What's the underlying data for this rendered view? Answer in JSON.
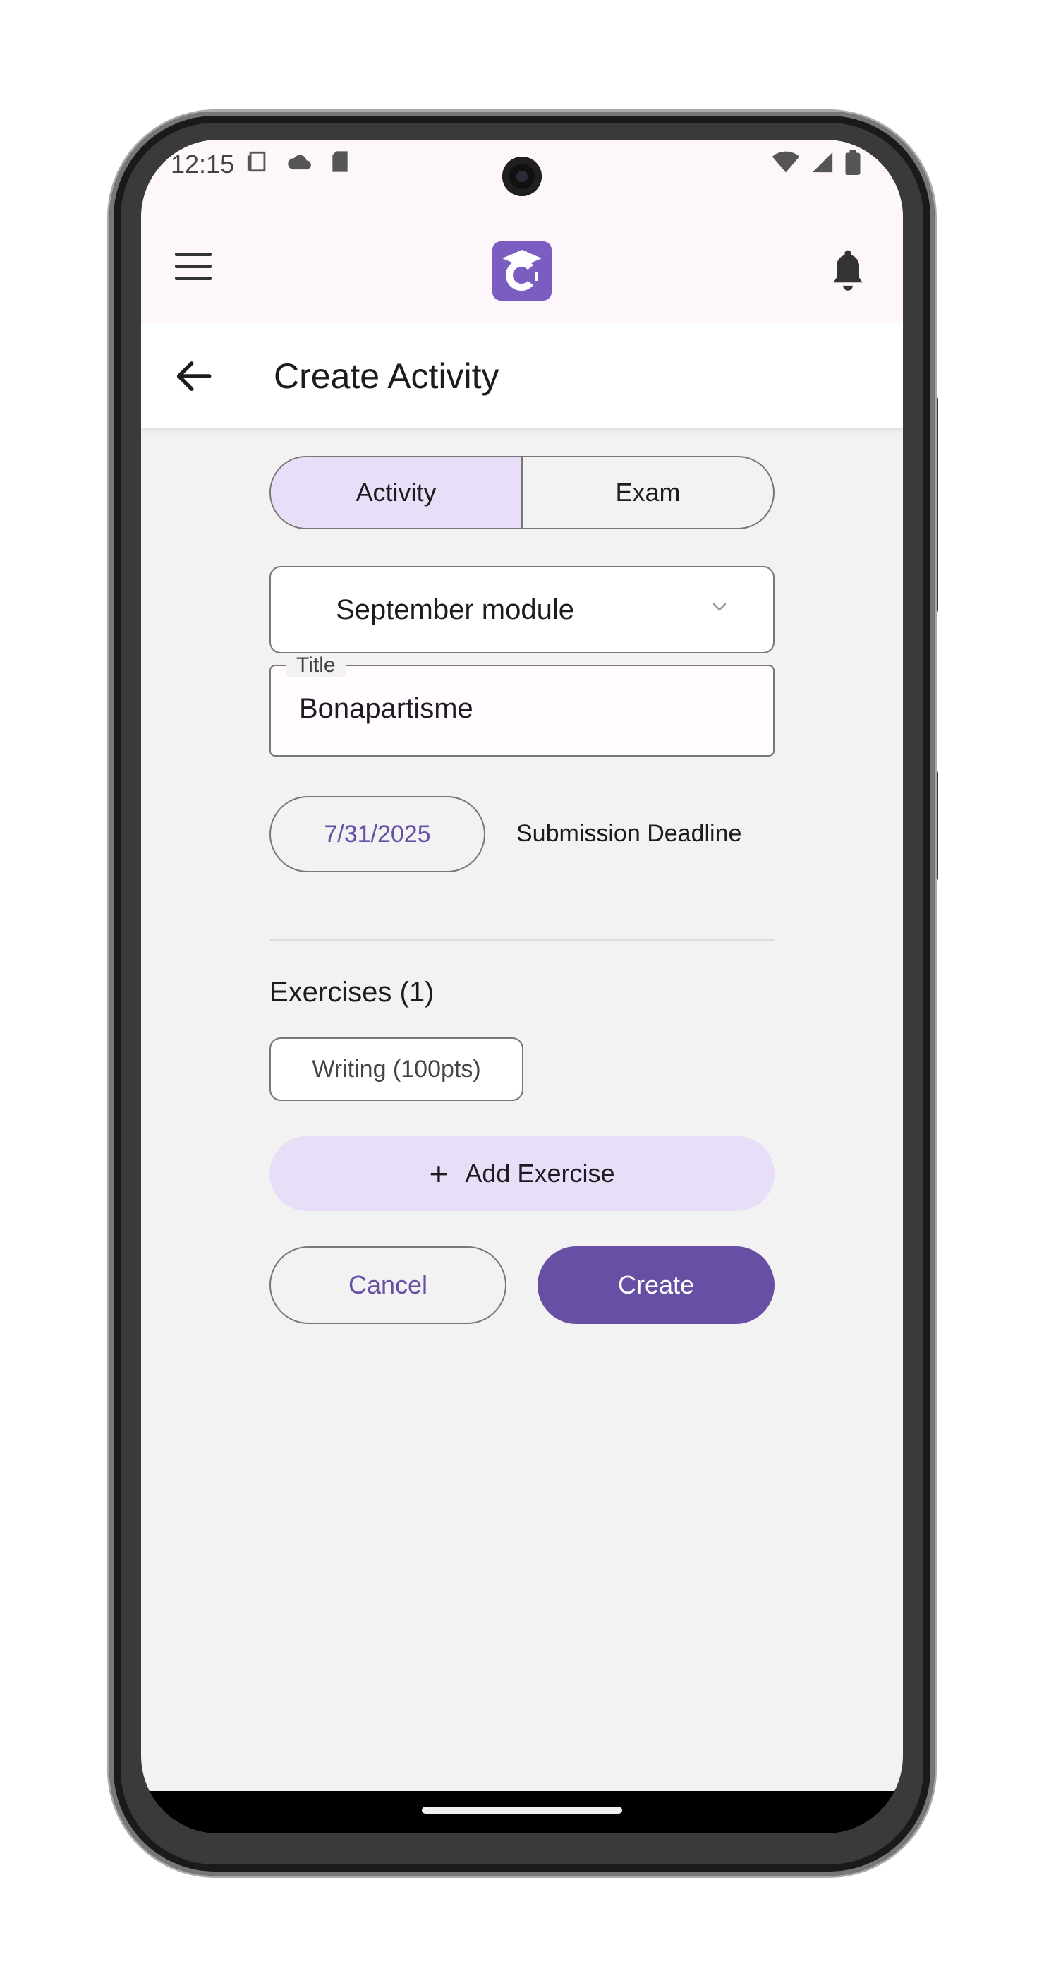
{
  "status_bar": {
    "time": "12:15",
    "left_icons": [
      "screenshot-icon",
      "cloud-icon",
      "sd-card-icon"
    ],
    "right_icons": [
      "wifi-icon",
      "signal-icon",
      "battery-icon"
    ]
  },
  "app_bar": {
    "logo_letter": "C",
    "accent_color": "#7b5cc0"
  },
  "title_bar": {
    "title": "Create Activity"
  },
  "form": {
    "segments": [
      {
        "label": "Activity",
        "selected": true
      },
      {
        "label": "Exam",
        "selected": false
      }
    ],
    "module_dropdown": {
      "value": "September module"
    },
    "title_field": {
      "label": "Title",
      "value": "Bonapartisme"
    },
    "deadline": {
      "date": "7/31/2025",
      "label": "Submission Deadline"
    },
    "exercises": {
      "heading": "Exercises (1)",
      "items": [
        "Writing (100pts)"
      ],
      "add_label": "Add Exercise"
    },
    "actions": {
      "cancel": "Cancel",
      "create": "Create"
    }
  },
  "colors": {
    "primary": "#6750a4",
    "secondary_container": "#e8def8",
    "background": "#f2f2f2"
  }
}
